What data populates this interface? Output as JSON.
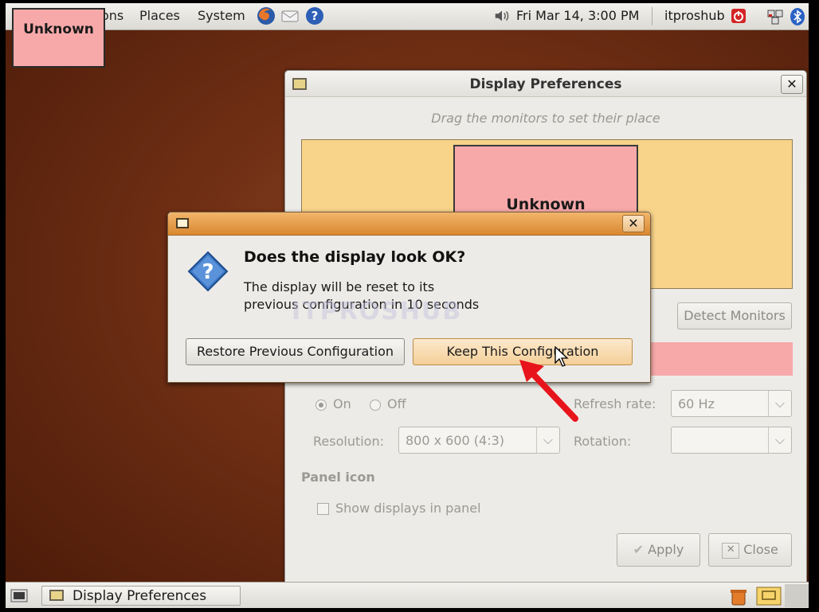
{
  "top_panel": {
    "menus": [
      "ons",
      "Places",
      "System"
    ],
    "clock": "Fri Mar 14,  3:00 PM",
    "user": "itproshub"
  },
  "overlay": {
    "label": "Unknown"
  },
  "prefs": {
    "title": "Display Preferences",
    "drag_hint": "Drag the monitors to set their place",
    "monitor_label": "Unknown",
    "detect_label": "Detect Monitors",
    "on_label": "On",
    "off_label": "Off",
    "refresh_label": "Refresh rate:",
    "refresh_value": "60 Hz",
    "resolution_label": "Resolution:",
    "resolution_value": "800 x 600 (4:3)",
    "rotation_label": "Rotation:",
    "rotation_value": "",
    "panel_icon_heading": "Panel icon",
    "show_displays_label": "Show displays in panel",
    "apply_label": "Apply",
    "close_label": "Close"
  },
  "dialog": {
    "heading": "Does the display look OK?",
    "message_line1": "The display will be reset to its",
    "message_line2": "previous configuration in 10 seconds",
    "restore_label": "Restore Previous Configuration",
    "keep_label": "Keep This Configuration",
    "watermark": "ITPROSHUB"
  },
  "taskbar": {
    "window_label": "Display Preferences"
  },
  "colors": {
    "dialog_titlebar": "#e09a45",
    "monitor_pink": "#f7a9a9",
    "monitor_area": "#f8d38a",
    "arrow_red": "#e8141b"
  }
}
